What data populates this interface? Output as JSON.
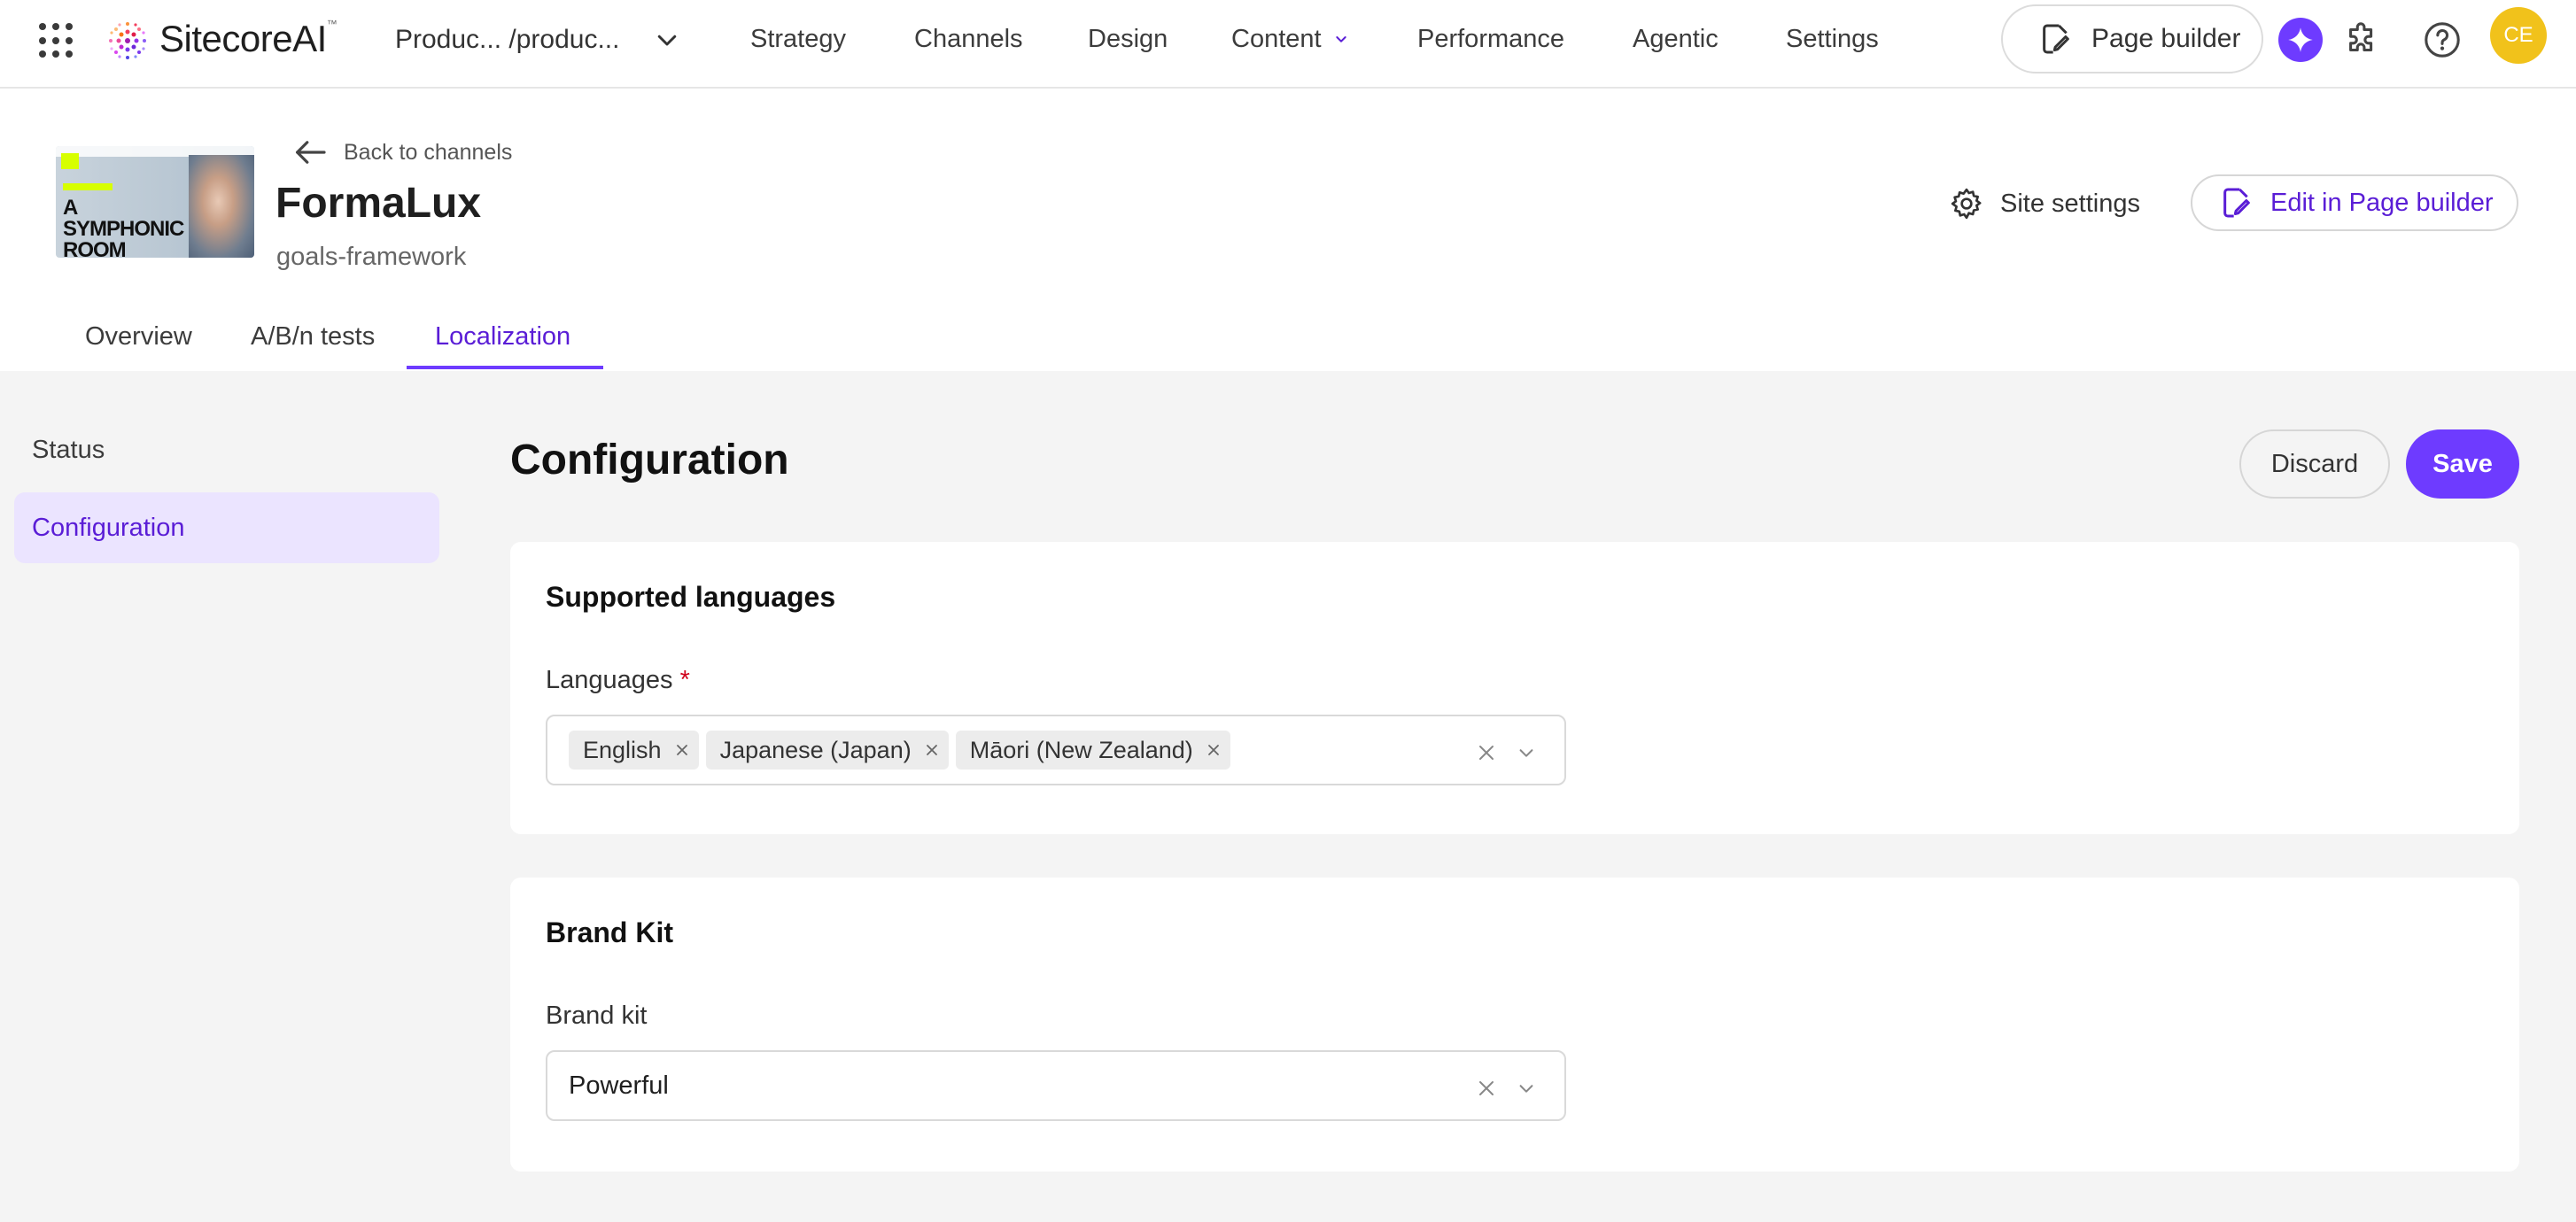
{
  "topnav": {
    "brand": "SitecoreAI",
    "brand_trademark": "™",
    "project": "Produc... /produc...",
    "items": [
      "Strategy",
      "Channels",
      "Design",
      "Content",
      "Performance",
      "Agentic",
      "Settings"
    ],
    "page_builder_label": "Page builder",
    "avatar_initials": "CE",
    "icons": [
      "app-grid-icon",
      "chevron-down-icon",
      "page-edit-icon",
      "ai-sparkle-icon",
      "puzzle-icon",
      "help-icon"
    ]
  },
  "site": {
    "back_label": "Back to channels",
    "name": "FormaLux",
    "subtitle": "goals-framework",
    "settings_label": "Site settings",
    "edit_label": "Edit in Page builder",
    "thumbnail_text": "A SYMPHONIC ROOM"
  },
  "tabs": [
    {
      "label": "Overview",
      "active": false
    },
    {
      "label": "A/B/n tests",
      "active": false
    },
    {
      "label": "Localization",
      "active": true
    }
  ],
  "sidebar": {
    "items": [
      {
        "label": "Status",
        "active": false
      },
      {
        "label": "Configuration",
        "active": true
      }
    ]
  },
  "main": {
    "title": "Configuration",
    "discard_label": "Discard",
    "save_label": "Save",
    "supported_languages": {
      "title": "Supported languages",
      "field_label": "Languages",
      "required_mark": "*",
      "selected": [
        "English",
        "Japanese (Japan)",
        "Māori (New Zealand)"
      ]
    },
    "brand_kit": {
      "title": "Brand Kit",
      "field_label": "Brand kit",
      "value": "Powerful"
    }
  },
  "colors": {
    "accent": "#6e3bff",
    "accent_text": "#5a1dd6",
    "accent_light": "#ebe4ff",
    "brand_ai": "#e4135f",
    "avatar": "#f1c21b",
    "content_bg": "#f4f4f4"
  }
}
